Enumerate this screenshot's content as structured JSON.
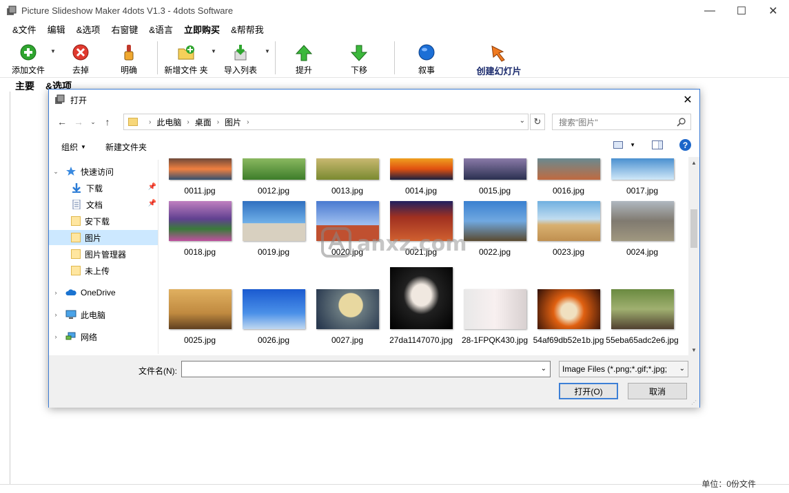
{
  "app": {
    "title": "Picture Slideshow Maker 4dots V1.3 - 4dots Software",
    "window_buttons": {
      "minimize": "—",
      "maximize": "☐",
      "close": "✕"
    }
  },
  "menu": [
    {
      "label": "&文件",
      "bold": false
    },
    {
      "label": "编辑",
      "bold": false
    },
    {
      "label": "&选项",
      "bold": false
    },
    {
      "label": "右窗键",
      "bold": false
    },
    {
      "label": "&语言",
      "bold": false
    },
    {
      "label": "立即购买",
      "bold": true
    },
    {
      "label": "&帮帮我",
      "bold": false
    }
  ],
  "toolbar": {
    "add_file": "添加文件",
    "remove": "去掉",
    "clear": "明确",
    "add_folder": "新增文件 夹",
    "import_list": "导入列表",
    "move_up": "提升",
    "move_down": "下移",
    "narration": "叙事",
    "create_slideshow": "创建幻灯片"
  },
  "main_tabs": {
    "main": "主要",
    "options": "&选项"
  },
  "statusbar": {
    "right": "单位：0份文件"
  },
  "dialog": {
    "title": "打开",
    "close": "✕",
    "breadcrumb": [
      "此电脑",
      "桌面",
      "图片"
    ],
    "search_placeholder": "搜索\"图片\"",
    "organize": "组织",
    "new_folder": "新建文件夹",
    "help": "?",
    "tree": [
      {
        "label": "快速访问",
        "icon": "star-icon",
        "pinned": false
      },
      {
        "label": "下载",
        "icon": "download-icon",
        "pinned": true
      },
      {
        "label": "文档",
        "icon": "document-icon",
        "pinned": true
      },
      {
        "label": "安下载",
        "icon": "folder-icon",
        "pinned": false
      },
      {
        "label": "图片",
        "icon": "folder-icon",
        "pinned": false,
        "selected": true
      },
      {
        "label": "图片管理器",
        "icon": "folder-icon",
        "pinned": false
      },
      {
        "label": "未上传",
        "icon": "folder-icon",
        "pinned": false
      },
      {
        "label": "OneDrive",
        "icon": "cloud-icon",
        "pinned": false
      },
      {
        "label": "此电脑",
        "icon": "computer-icon",
        "pinned": false
      },
      {
        "label": "网络",
        "icon": "network-icon",
        "pinned": false
      }
    ],
    "files_row1": [
      "0011.jpg",
      "0012.jpg",
      "0013.jpg",
      "0014.jpg",
      "0015.jpg",
      "0016.jpg",
      "0017.jpg"
    ],
    "files_row2": [
      "0018.jpg",
      "0019.jpg",
      "0020.jpg",
      "0021.jpg",
      "0022.jpg",
      "0023.jpg",
      "0024.jpg"
    ],
    "files_row3": [
      "0025.jpg",
      "0026.jpg",
      "0027.jpg",
      "27da1147070.jpg",
      "28-1FPQK430.jpg",
      "54af69db52e1b.jpg",
      "55eba65adc2e6.jpg"
    ],
    "filename_label": "文件名(N):",
    "filename_value": "",
    "filetype": "Image Files (*.png;*.gif;*.jpg;",
    "open_button": "打开(O)",
    "cancel_button": "取消"
  },
  "watermark": "anxz.com"
}
